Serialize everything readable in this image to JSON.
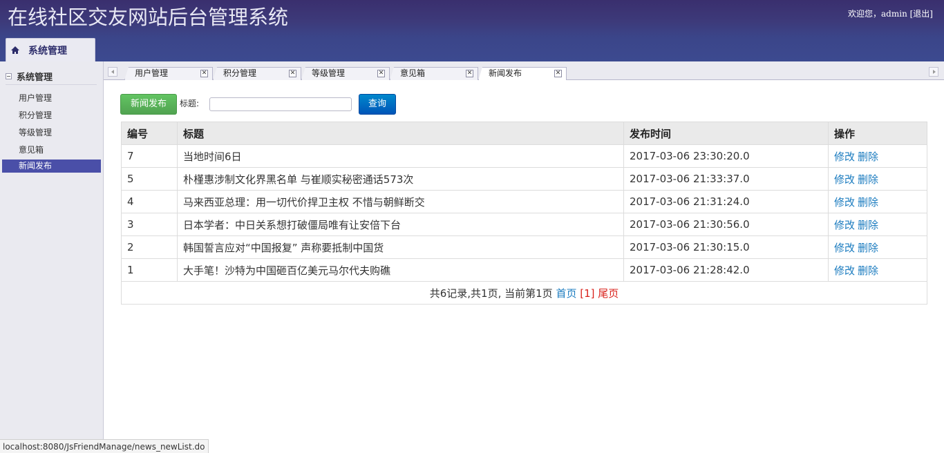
{
  "header": {
    "title": "在线社区交友网站后台管理系统",
    "welcome_prefix": "欢迎您，",
    "username": "admin",
    "logout": "[退出]",
    "menu_tab": "系统管理"
  },
  "sidebar": {
    "section_title": "系统管理",
    "items": [
      {
        "label": "用户管理",
        "active": false
      },
      {
        "label": "积分管理",
        "active": false
      },
      {
        "label": "等级管理",
        "active": false
      },
      {
        "label": "意见箱",
        "active": false
      },
      {
        "label": "新闻发布",
        "active": true
      }
    ]
  },
  "tabs": [
    {
      "label": "用户管理",
      "active": false
    },
    {
      "label": "积分管理",
      "active": false
    },
    {
      "label": "等级管理",
      "active": false
    },
    {
      "label": "意见箱",
      "active": false
    },
    {
      "label": "新闻发布",
      "active": true
    }
  ],
  "toolbar": {
    "add_button": "新闻发布",
    "title_label": "标题:",
    "title_value": "",
    "query_button": "查询"
  },
  "table": {
    "headers": [
      "编号",
      "标题",
      "发布时间",
      "操作"
    ],
    "rows": [
      {
        "id": "7",
        "title": "当地时间6日",
        "time": "2017-03-06 23:30:20.0",
        "edit": "修改",
        "delete": "删除"
      },
      {
        "id": "5",
        "title": "朴槿惠涉制文化界黑名单 与崔顺实秘密通话573次",
        "time": "2017-03-06 21:33:37.0",
        "edit": "修改",
        "delete": "删除"
      },
      {
        "id": "4",
        "title": "马来西亚总理：用一切代价捍卫主权 不惜与朝鲜断交",
        "time": "2017-03-06 21:31:24.0",
        "edit": "修改",
        "delete": "删除"
      },
      {
        "id": "3",
        "title": "日本学者：中日关系想打破僵局唯有让安倍下台",
        "time": "2017-03-06 21:30:56.0",
        "edit": "修改",
        "delete": "删除"
      },
      {
        "id": "2",
        "title": "韩国誓言应对“中国报复” 声称要抵制中国货",
        "time": "2017-03-06 21:30:15.0",
        "edit": "修改",
        "delete": "删除"
      },
      {
        "id": "1",
        "title": "大手笔！沙特为中国砸百亿美元马尔代夫购礁",
        "time": "2017-03-06 21:28:42.0",
        "edit": "修改",
        "delete": "删除"
      }
    ]
  },
  "pager": {
    "summary": "共6记录,共1页, 当前第1页",
    "first": "首页",
    "current": "[1]",
    "last": "尾页"
  },
  "status_url": "localhost:8080/JsFriendManage/news_newList.do",
  "colors": {
    "header_bg": "#3c4a90",
    "sidebar_active": "#4a4fa8",
    "btn_green": "#5bb75b",
    "btn_blue": "#006dcc",
    "link": "#1a7bbf",
    "pager_current": "#d9211b"
  }
}
